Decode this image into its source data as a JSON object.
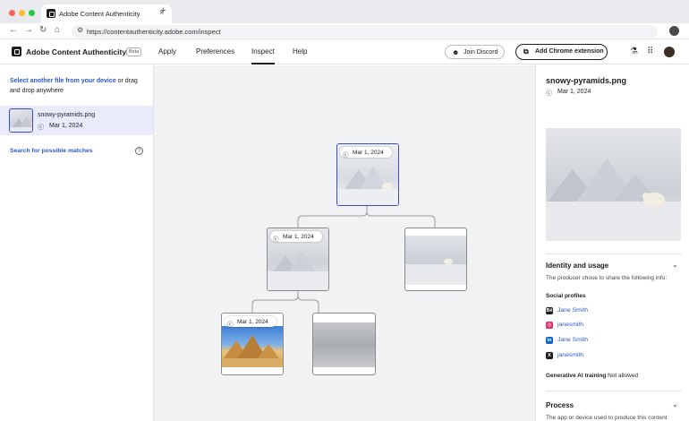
{
  "browser": {
    "tab_title": "Adobe Content Authenticity",
    "tab_close": "×",
    "new_tab": "+",
    "url": "https://contentauthenticity.adobe.com/inspect",
    "back": "←",
    "forward": "→",
    "reload": "↻",
    "home": "⌂"
  },
  "header": {
    "app_name": "Adobe Content Authenticity",
    "beta": "Beta",
    "nav": [
      "Apply",
      "Preferences",
      "Inspect",
      "Help"
    ],
    "active_nav": "Inspect",
    "discord": "Join Discord",
    "chrome_ext": "Add Chrome extension"
  },
  "left": {
    "select_link": "Select another file from your device",
    "select_rest": " or drag and drop anywhere",
    "file": {
      "name": "snowy-pyramids.png",
      "date": "Mar 1, 2024"
    },
    "search_matches": "Search for possible matches",
    "help": "?"
  },
  "tree": {
    "root": {
      "date": "Mar 1, 2024"
    },
    "mid_left": {
      "date": "Mar 1, 2024"
    },
    "bottom_left": {
      "date": "Mar 1, 2024"
    }
  },
  "right": {
    "title": "snowy-pyramids.png",
    "date": "Mar 1, 2024",
    "identity": {
      "title": "Identity and usage",
      "desc": "The producer chose to share the following info:",
      "social_head": "Social profiles",
      "profiles": [
        {
          "network": "behance-icon",
          "name": "Jane Smith",
          "color": "#1c1c1c",
          "glyph": "Bē"
        },
        {
          "network": "instagram-icon",
          "name": "janesmith",
          "color": "#d6336c",
          "glyph": "◎"
        },
        {
          "network": "linkedin-icon",
          "name": "Jane Smith",
          "color": "#0a66c2",
          "glyph": "in"
        },
        {
          "network": "x-icon",
          "name": "janesmith",
          "color": "#1c1c1c",
          "glyph": "X"
        }
      ],
      "ai_label": "Generative AI training",
      "ai_value": "Not allowed"
    },
    "process": {
      "title": "Process",
      "desc": "The app or device used to produce this content"
    }
  },
  "colors": {
    "accent": "#3b4dbf",
    "link": "#2b57c8"
  }
}
